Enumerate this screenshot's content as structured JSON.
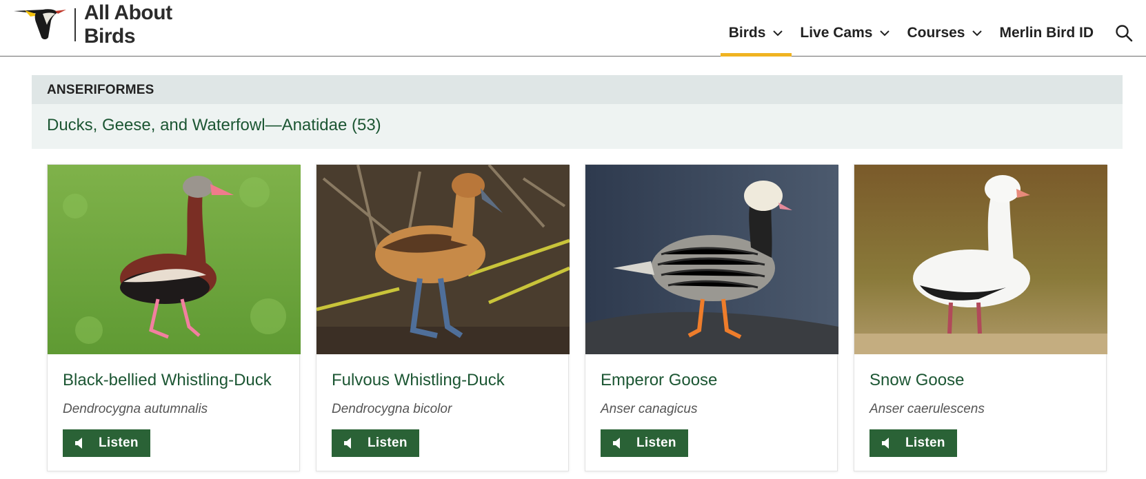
{
  "site": {
    "name": "All About Birds"
  },
  "nav": [
    {
      "label": "Birds",
      "has_dropdown": true,
      "active": true
    },
    {
      "label": "Live Cams",
      "has_dropdown": true,
      "active": false
    },
    {
      "label": "Courses",
      "has_dropdown": true,
      "active": false
    },
    {
      "label": "Merlin Bird ID",
      "has_dropdown": false,
      "active": false
    }
  ],
  "section": {
    "order": "ANSERIFORMES",
    "family": "Ducks, Geese, and Waterfowl—Anatidae (53)"
  },
  "cards": [
    {
      "name": "Black-bellied Whistling-Duck",
      "scientific": "Dendrocygna autumnalis",
      "listen": "Listen",
      "photo": "black-bellied-whistling-duck-photo"
    },
    {
      "name": "Fulvous Whistling-Duck",
      "scientific": "Dendrocygna bicolor",
      "listen": "Listen",
      "photo": "fulvous-whistling-duck-photo"
    },
    {
      "name": "Emperor Goose",
      "scientific": "Anser canagicus",
      "listen": "Listen",
      "photo": "emperor-goose-photo"
    },
    {
      "name": "Snow Goose",
      "scientific": "Anser caerulescens",
      "listen": "Listen",
      "photo": "snow-goose-photo"
    }
  ],
  "colors": {
    "accent": "#f0b321",
    "link_green": "#1c5633",
    "button_green": "#2a6236",
    "order_bar": "#dfe6e6",
    "family_bar": "#eef3f2"
  },
  "icons": [
    "chevron-down-icon",
    "search-icon",
    "speaker-icon"
  ]
}
